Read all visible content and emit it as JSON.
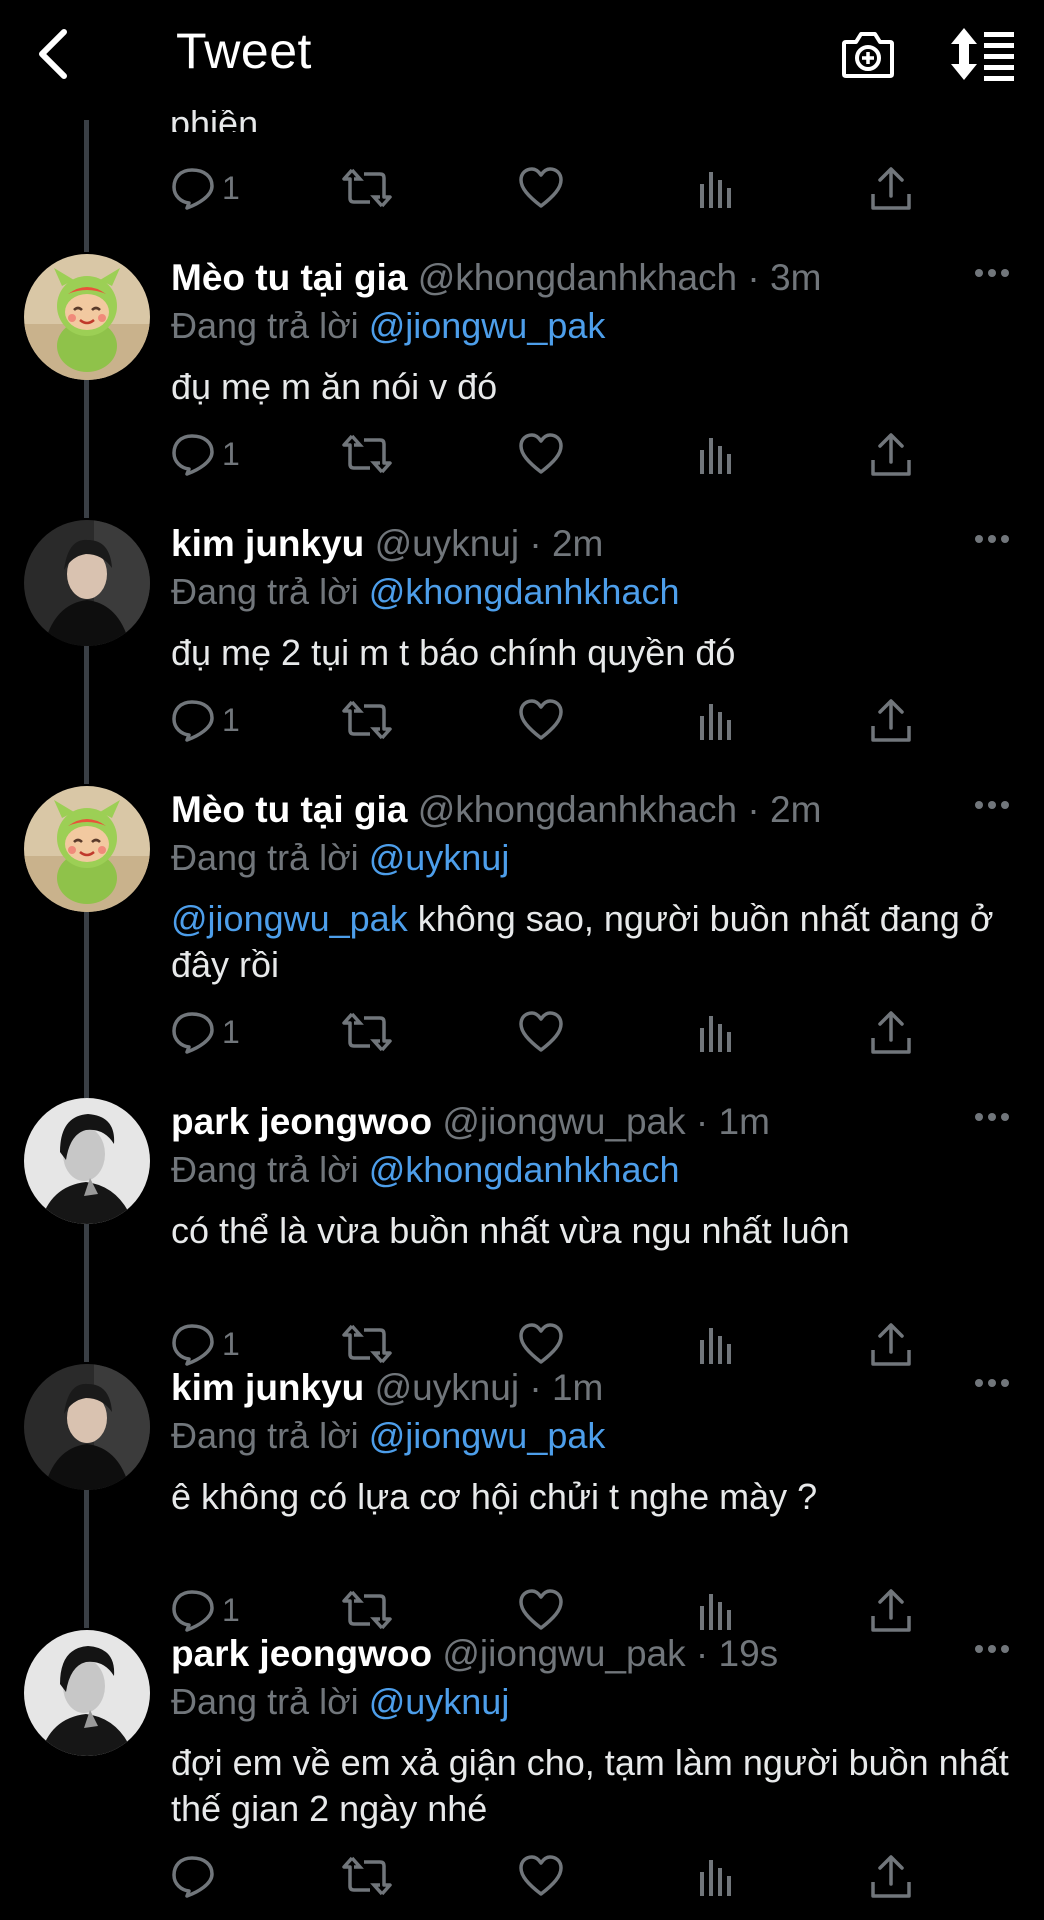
{
  "header": {
    "title": "Tweet",
    "back_icon": "back-arrow-icon",
    "camera_icon": "camera-plus-icon",
    "sort_icon": "sort-list-icon"
  },
  "partial_tweet": {
    "text": "phiền",
    "reply_count": "1"
  },
  "tweets": [
    {
      "name": "Mèo tu tại gia",
      "handle": "@khongdanhkhach",
      "time": "· 3m",
      "replying_label": "Đang trả lời",
      "replying_to": "@jiongwu_pak",
      "body_mention": "",
      "body": "đụ mẹ m ăn nói v đó",
      "reply_count": "1"
    },
    {
      "name": "kim junkyu",
      "handle": "@uyknuj",
      "time": "· 2m",
      "replying_label": "Đang trả lời",
      "replying_to": "@khongdanhkhach",
      "body_mention": "",
      "body": "đụ mẹ 2 tụi m t báo chính quyền đó",
      "reply_count": "1"
    },
    {
      "name": "Mèo tu tại gia",
      "handle": "@khongdanhkhach",
      "time": "· 2m",
      "replying_label": "Đang trả lời",
      "replying_to": "@uyknuj",
      "body_mention": "@jiongwu_pak",
      "body": " không sao, người buồn nhất đang ở đây rồi",
      "reply_count": "1"
    },
    {
      "name": "park jeongwoo",
      "handle": "@jiongwu_pak",
      "time": "· 1m",
      "replying_label": "Đang trả lời",
      "replying_to": "@khongdanhkhach",
      "body_mention": "",
      "body": "có thể là vừa buồn nhất vừa ngu nhất luôn",
      "reply_count": "1"
    },
    {
      "name": "kim junkyu",
      "handle": "@uyknuj",
      "time": "· 1m",
      "replying_label": "Đang trả lời",
      "replying_to": "@jiongwu_pak",
      "body_mention": "",
      "body": "ê không có lựa cơ hội chửi t nghe mày ?",
      "reply_count": "1"
    },
    {
      "name": "park jeongwoo",
      "handle": "@jiongwu_pak",
      "time": "· 19s",
      "replying_label": "Đang trả lời",
      "replying_to": "@uyknuj",
      "body_mention": "",
      "body": "đợi em về em xả giận cho, tạm làm người buồn nhất thế gian 2 ngày nhé",
      "reply_count": ""
    }
  ],
  "colors": {
    "background": "#000000",
    "text": "#e7e9ea",
    "muted": "#71767b",
    "mention": "#4d9eea",
    "thread_line": "#3a3f45"
  }
}
